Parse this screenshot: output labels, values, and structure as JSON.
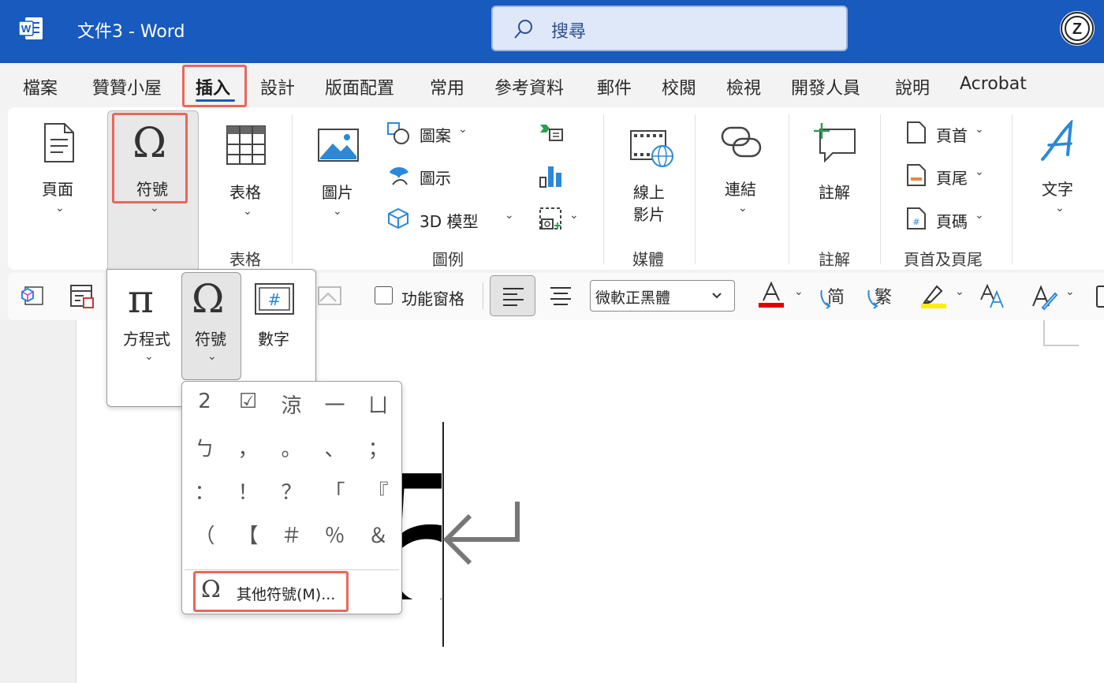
{
  "titlebar": {
    "app_icon": "word-logo",
    "doc_title": "文件3  -  Word",
    "search_placeholder": "搜尋",
    "account_icon": "account-icon"
  },
  "tabs": [
    "檔案",
    "贊贊小屋",
    "插入",
    "設計",
    "版面配置",
    "常用",
    "參考資料",
    "郵件",
    "校閱",
    "檢視",
    "開發人員",
    "說明",
    "Acrobat"
  ],
  "active_tab": "插入",
  "ribbon": {
    "pages": "頁面",
    "symbols": "符號",
    "table": "表格",
    "table_group": "表格",
    "pictures": "圖片",
    "shapes": "圖案",
    "icons": "圖示",
    "models3d": "3D 模型",
    "illustrations_group": "圖例",
    "online_video_line1": "線上",
    "online_video_line2": "影片",
    "media_group": "媒體",
    "links": "連結",
    "comment": "註解",
    "comments_group": "註解",
    "header": "頁首",
    "footer": "頁尾",
    "page_number": "頁碼",
    "header_footer_group": "頁首及頁尾",
    "text": "文字"
  },
  "toolbar2": {
    "nav_pane_label": "功能窗格",
    "font_name": "微軟正黑體",
    "font_color": "#e00000",
    "highlight_color": "#ffee00",
    "simplified": "简",
    "traditional": "繁"
  },
  "symbols_popup": {
    "equation": "方程式",
    "symbol": "符號",
    "number": "數字"
  },
  "symbol_gallery": {
    "items": [
      "2",
      "☑",
      "涼",
      "一",
      "ㄩ",
      "ㄅ",
      "，",
      "。",
      "、",
      "；",
      "：",
      "！",
      "？",
      "「",
      "『",
      "（",
      "【",
      "＃",
      "％",
      "＆"
    ],
    "more_symbols": "其他符號(M)..."
  },
  "document": {
    "visible_char": "5"
  },
  "colors": {
    "accent": "#185abd",
    "highlight_box": "#e8675c"
  }
}
